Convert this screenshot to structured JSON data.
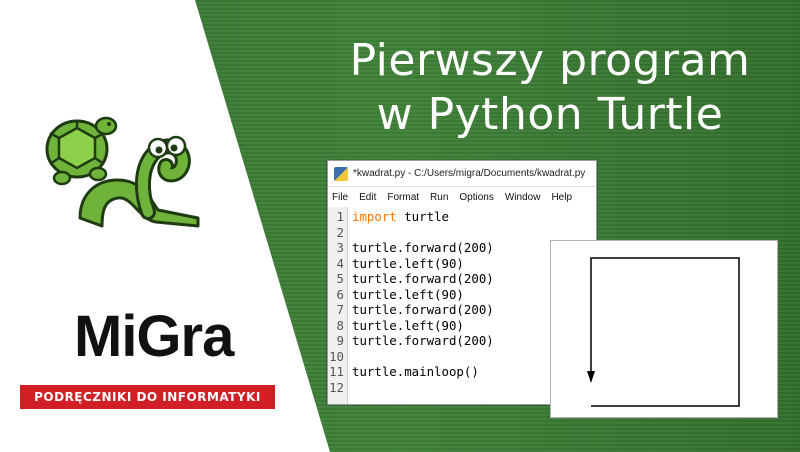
{
  "title": {
    "line1": "Pierwszy program",
    "line2": "w Python Turtle"
  },
  "brand": {
    "logo": "MiGra",
    "tagline": "PODRĘCZNIKI DO INFORMATYKI"
  },
  "editor": {
    "window_title": "*kwadrat.py - C:/Users/migra/Documents/kwadrat.py",
    "menu": [
      "File",
      "Edit",
      "Format",
      "Run",
      "Options",
      "Window",
      "Help"
    ],
    "line_numbers": [
      "1",
      "2",
      "3",
      "4",
      "5",
      "6",
      "7",
      "8",
      "9",
      "10",
      "11",
      "12"
    ],
    "code_lines": [
      {
        "kw": "import",
        "rest": " turtle"
      },
      {
        "kw": "",
        "rest": ""
      },
      {
        "kw": "",
        "rest": "turtle.forward(200)"
      },
      {
        "kw": "",
        "rest": "turtle.left(90)"
      },
      {
        "kw": "",
        "rest": "turtle.forward(200)"
      },
      {
        "kw": "",
        "rest": "turtle.left(90)"
      },
      {
        "kw": "",
        "rest": "turtle.forward(200)"
      },
      {
        "kw": "",
        "rest": "turtle.left(90)"
      },
      {
        "kw": "",
        "rest": "turtle.forward(200)"
      },
      {
        "kw": "",
        "rest": ""
      },
      {
        "kw": "",
        "rest": "turtle.mainloop()"
      },
      {
        "kw": "",
        "rest": ""
      }
    ]
  },
  "colors": {
    "background_green": "#3c7d35",
    "brand_red": "#d21f26",
    "keyword_orange": "#ff7700"
  }
}
